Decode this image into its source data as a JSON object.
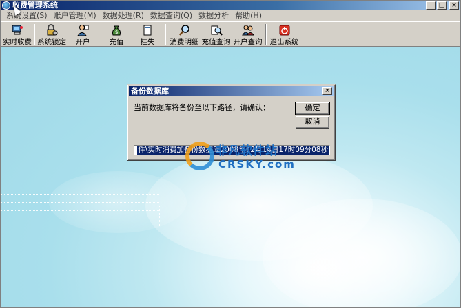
{
  "window": {
    "title": "收费管理系统"
  },
  "menu": [
    {
      "label": "系统设置(S)"
    },
    {
      "label": "账户管理(M)"
    },
    {
      "label": "数据处理(R)"
    },
    {
      "label": "数据查询(Q)"
    },
    {
      "label": "数据分析"
    },
    {
      "label": "帮助(H)"
    }
  ],
  "toolbar": {
    "realtime_pay": "实时收费",
    "lock": "系统锁定",
    "open_account": "开户",
    "recharge": "充值",
    "report_loss": "挂失",
    "consume_detail": "消费明细",
    "recharge_query": "充值查询",
    "account_query": "开户查询",
    "exit": "退出系统"
  },
  "dialog": {
    "title": "备份数据库",
    "message": "当前数据库将备份至以下路径，请确认：",
    "ok": "确定",
    "cancel": "取消",
    "path": "件\\实时消费加备份数据库2008年12月14日17时09分08秒"
  },
  "watermark": {
    "cn": "非凡软件站",
    "en": "CRSKY.com"
  }
}
